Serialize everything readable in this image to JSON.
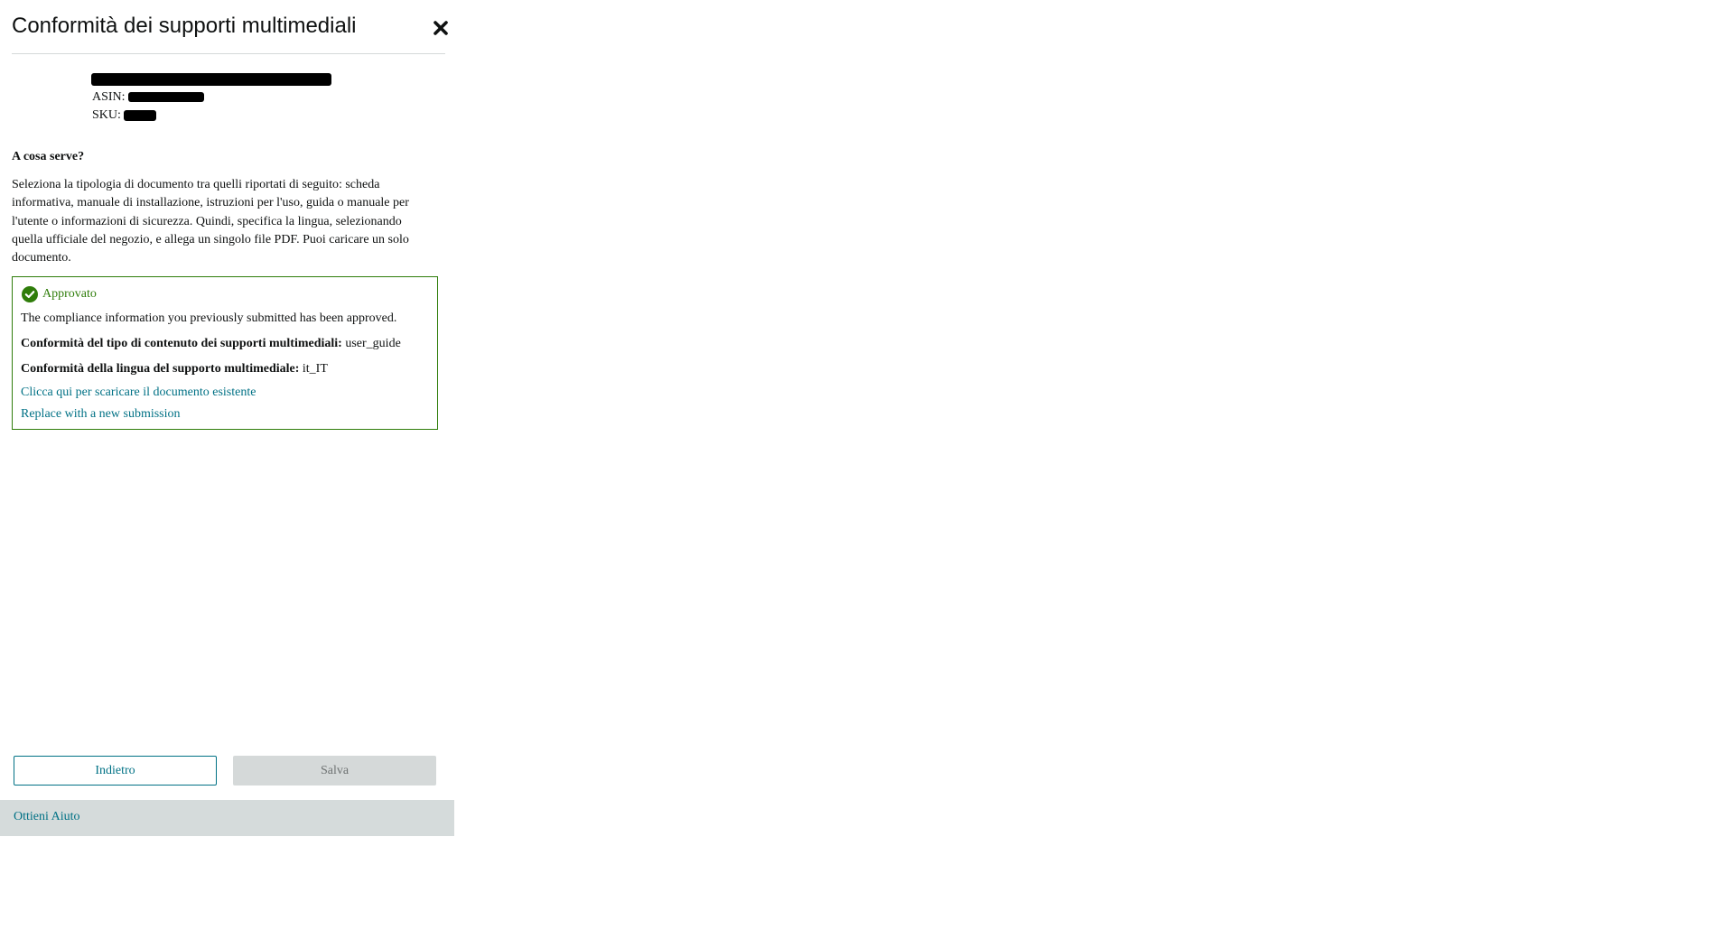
{
  "dialog": {
    "title": "Conformità dei supporti multimediali",
    "close_icon": "close-icon"
  },
  "product": {
    "asin_label": "ASIN:",
    "sku_label": "SKU:"
  },
  "info": {
    "heading": "A cosa serve?",
    "description": "Seleziona la tipologia di documento tra quelli riportati di seguito: scheda informativa, manuale di installazione, istruzioni per l'uso, guida o manuale per l'utente o informazioni di sicurezza. Quindi, specifica la lingua, selezionando quella ufficiale del negozio, e allega un singolo file PDF. Puoi caricare un solo documento."
  },
  "status": {
    "icon": "check-circle-icon",
    "label": "Approvato",
    "color": "#2f7d0a",
    "message": "The compliance information you previously submitted has been approved.",
    "content_type_label": "Conformità del tipo di contenuto dei supporti multimediali:",
    "content_type_value": "user_guide",
    "language_label": "Conformità della lingua del supporto multimediale:",
    "language_value": "it_IT",
    "download_link": "Clicca qui per scaricare il documento esistente",
    "replace_link": "Replace with a new submission"
  },
  "actions": {
    "back_label": "Indietro",
    "save_label": "Salva"
  },
  "footer": {
    "help_label": "Ottieni Aiuto"
  },
  "colors": {
    "link": "#007185",
    "success": "#2f7d0a",
    "disabled_bg": "#d5d9d9",
    "footer_bg": "#d5dbdb"
  }
}
